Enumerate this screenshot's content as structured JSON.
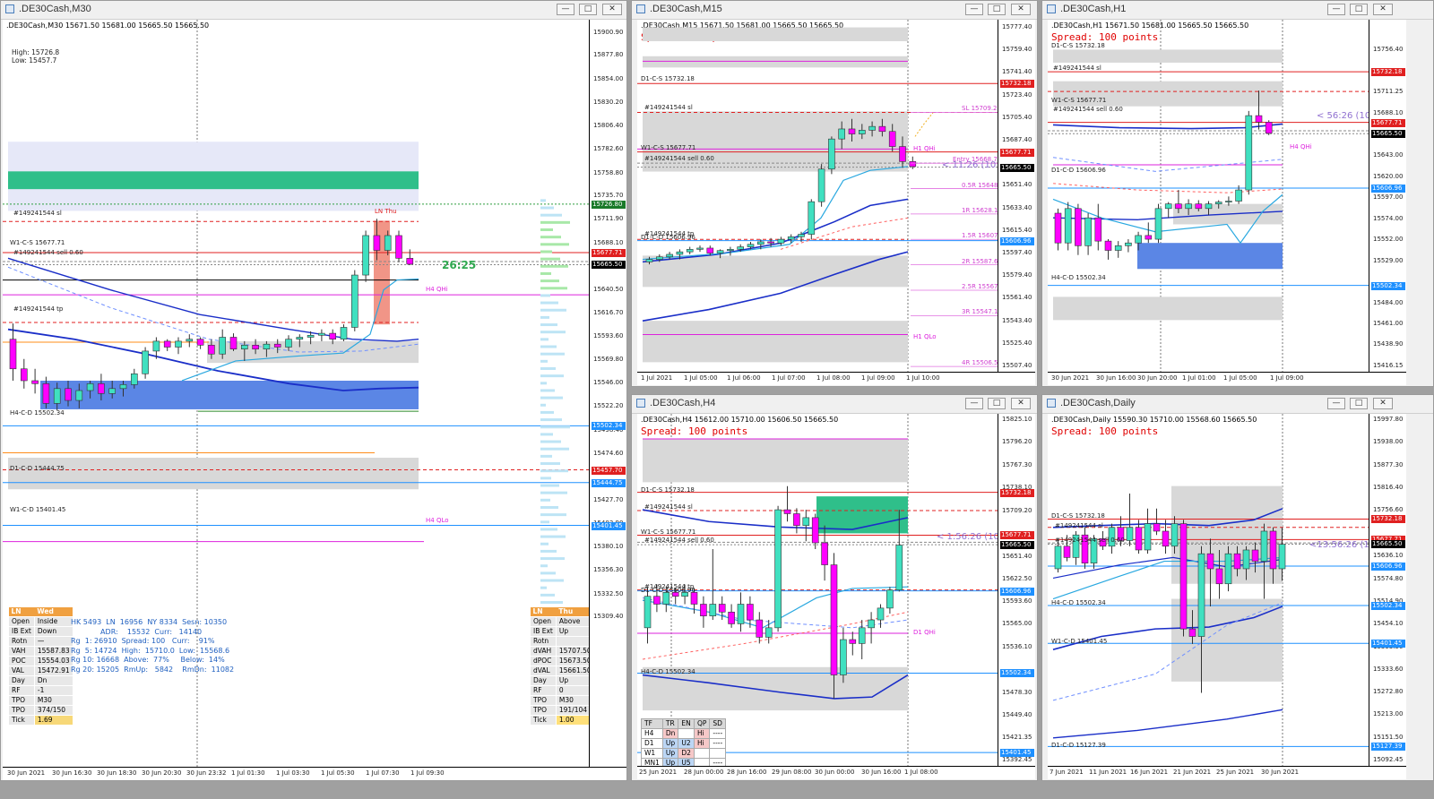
{
  "windows": {
    "m30": {
      "title": ".DE30Cash,M30",
      "header": ".DE30Cash,M30  15671.50 15681.00 15665.50 15665.50",
      "high": "High: 15726.8",
      "low": "Low: 15457.7",
      "timer": "26:25",
      "labels": {
        "sl": "#149241544 sl",
        "w1cs": "W1-C-S 15677.71",
        "sell": "#149241544 sell 0.60",
        "tp": "#149241544 tp",
        "h4qhi": "H4 QHi",
        "h4cd": "H4-C-D 15502.34",
        "d1cd": "D1-C-D 15444.75",
        "w1cd": "W1-C-D 15401.45",
        "h4qlo": "H4 QLo",
        "lnthu": "LN Thu"
      },
      "prices": [
        "15900.90",
        "15877.80",
        "15854.00",
        "15830.20",
        "15806.40",
        "15782.60",
        "15758.80",
        "15735.70",
        "15711.90",
        "15688.10",
        "15640.50",
        "15616.70",
        "15593.60",
        "15569.80",
        "15546.00",
        "15522.20",
        "15498.40",
        "15474.60",
        "15427.70",
        "15403.90",
        "15380.10",
        "15356.30",
        "15332.50",
        "15309.40"
      ],
      "price_boxes": [
        {
          "v": "15726.80",
          "color": "#1a7a2a"
        },
        {
          "v": "15677.71",
          "color": "#e02020"
        },
        {
          "v": "15665.50",
          "color": "#000000"
        },
        {
          "v": "15502.34",
          "color": "#1e90ff"
        },
        {
          "v": "15457.70",
          "color": "#e02020"
        },
        {
          "v": "15444.75",
          "color": "#1e90ff"
        },
        {
          "v": "15401.45",
          "color": "#1e90ff"
        }
      ],
      "times": [
        "30 Jun 2021",
        "30 Jun 16:30",
        "30 Jun 18:30",
        "30 Jun 20:30",
        "30 Jun 23:32",
        "1 Jul 01:30",
        "1 Jul 03:30",
        "1 Jul 05:30",
        "1 Jul 07:30",
        "1 Jul 09:30"
      ],
      "left_table": {
        "hdr": [
          "LN",
          "Wed"
        ],
        "rows": [
          [
            "Open",
            "Inside"
          ],
          [
            "IB Ext",
            "Down"
          ],
          [
            "Rotn",
            "—"
          ],
          [
            "VAH",
            "15587.83"
          ],
          [
            "POC",
            "15554.03"
          ],
          [
            "VAL",
            "15472.91"
          ],
          [
            "Day",
            "Dn"
          ],
          [
            "RF",
            "-1"
          ],
          [
            "TPO",
            "M30"
          ],
          [
            "TPO",
            "374/150"
          ],
          [
            "Tick",
            "1.69"
          ]
        ]
      },
      "stats": [
        "HK 5493  LN  16956  NY 8334  Sesn: 10350",
        "             ADR:    15532  Curr:   14140",
        "Rg  1: 26910  Spread: 100   Curr:    91%",
        "Rg  5: 14724  High:  15710.0  Low:  15568.6",
        "Rg 10: 16668  Above:  77%     Below:  14%",
        "Rg 20: 15205  RmUp:   5842    RmDn:  11082"
      ],
      "right_table": {
        "hdr": [
          "LN",
          "Thu"
        ],
        "rows": [
          [
            "Open",
            "Above"
          ],
          [
            "IB Ext",
            "Up"
          ],
          [
            "Rotn",
            ""
          ],
          [
            "dVAH",
            "15707.50"
          ],
          [
            "dPOC",
            "15673.50"
          ],
          [
            "dVAL",
            "15661.50"
          ],
          [
            "Day",
            "Up"
          ],
          [
            "RF",
            "0"
          ],
          [
            "TPO",
            "M30"
          ],
          [
            "TPO",
            "191/104"
          ],
          [
            "Tick",
            "1.00"
          ]
        ]
      }
    },
    "m15": {
      "title": ".DE30Cash,M15",
      "header": ".DE30Cash,M15  15671.50 15681.00 15665.50 15665.50",
      "spread": "Spread: 100 points",
      "timer": "< 11:26 (10",
      "labels": {
        "d1cs": "D1-C-S 15732.18",
        "sl": "#149241544 sl",
        "w1cs": "W1-C-S 15677.71",
        "sell": "#149241544 sell 0.60",
        "tp": "#149241544 tp",
        "d1cd": "D1-C-D 15606.96",
        "h1qhi": "H1 QHi",
        "h1qlo": "H1 QLo",
        "fib": [
          "SL 15709.23",
          "Entry 15668.71",
          "0.5R 15648.44",
          "1R 15628.18",
          "1.5R 15607.91",
          "2R 15587.65",
          "2.5R 15567.39",
          "3R 15547.12",
          "4R 15506.59"
        ]
      },
      "prices": [
        "15777.40",
        "15759.40",
        "15741.40",
        "15723.40",
        "15705.40",
        "15687.40",
        "15651.40",
        "15633.40",
        "15615.40",
        "15597.40",
        "15579.40",
        "15561.40",
        "15543.40",
        "15525.40",
        "15507.40"
      ],
      "price_boxes": [
        {
          "v": "15732.18",
          "color": "#e02020"
        },
        {
          "v": "15677.71",
          "color": "#e02020"
        },
        {
          "v": "15665.50",
          "color": "#000000"
        },
        {
          "v": "15606.96",
          "color": "#1e90ff"
        }
      ],
      "times": [
        "1 Jul 2021",
        "1 Jul 05:00",
        "1 Jul 06:00",
        "1 Jul 07:00",
        "1 Jul 08:00",
        "1 Jul 09:00",
        "1 Jul 10:00"
      ]
    },
    "h1": {
      "title": ".DE30Cash,H1",
      "header": ".DE30Cash,H1  15671.50 15681.00 15665.50 15665.50",
      "spread": "Spread: 100 points",
      "timer": "< 56:26 (10",
      "labels": {
        "d1cs": "D1-C-S 15732.18",
        "sl": "#149241544 sl",
        "w1cs": "W1-C-S 15677.71",
        "sell": "#149241544 sell 0.60",
        "h4qhi": "H4 QHi",
        "d1cd": "D1-C-D 15606.96",
        "h4cd": "H4-C-D 15502.34"
      },
      "prices": [
        "15756.40",
        "15711.25",
        "15688.10",
        "15643.00",
        "15620.00",
        "15597.00",
        "15574.00",
        "15552.00",
        "15529.00",
        "15484.00",
        "15461.00",
        "15438.90",
        "15416.15"
      ],
      "price_boxes": [
        {
          "v": "15732.18",
          "color": "#e02020"
        },
        {
          "v": "15677.71",
          "color": "#e02020"
        },
        {
          "v": "15665.50",
          "color": "#000000"
        },
        {
          "v": "15606.96",
          "color": "#1e90ff"
        },
        {
          "v": "15502.34",
          "color": "#1e90ff"
        }
      ],
      "times": [
        "30 Jun 2021",
        "30 Jun 16:00",
        "30 Jun 20:00",
        "1 Jul 01:00",
        "1 Jul 05:00",
        "1 Jul 09:00"
      ]
    },
    "h4": {
      "title": ".DE30Cash,H4",
      "header": ".DE30Cash,H4  15612.00 15710.00 15606.50 15665.50",
      "spread": "Spread: 100 points",
      "timer": "< 1:56:26 (10",
      "labels": {
        "d1cs": "D1-C-S 15732.18",
        "sl": "#149241544 sl",
        "w1cs": "W1-C-S 15677.71",
        "sell": "#149241544 sell 0.60",
        "tp": "#149241544 tp",
        "d1cd": "D1-C-D 15606.96",
        "d1qhi": "D1 QHi",
        "h4cd": "H4-C-D 15502.34"
      },
      "prices": [
        "15825.10",
        "15796.20",
        "15767.30",
        "15738.10",
        "15709.20",
        "15651.40",
        "15622.50",
        "15593.60",
        "15565.00",
        "15536.10",
        "15478.30",
        "15449.40",
        "15421.35",
        "15392.45"
      ],
      "price_boxes": [
        {
          "v": "15732.18",
          "color": "#e02020"
        },
        {
          "v": "15677.71",
          "color": "#e02020"
        },
        {
          "v": "15665.50",
          "color": "#000000"
        },
        {
          "v": "15606.96",
          "color": "#1e90ff"
        },
        {
          "v": "15502.34",
          "color": "#1e90ff"
        },
        {
          "v": "15401.45",
          "color": "#1e90ff"
        }
      ],
      "times": [
        "25 Jun 2021",
        "28 Jun 00:00",
        "28 Jun 16:00",
        "29 Jun 08:00",
        "30 Jun 00:00",
        "30 Jun 16:00",
        "1 Jul 08:00"
      ],
      "trend_table": {
        "hdr": [
          "TF",
          "TR",
          "EN",
          "QP",
          "SD"
        ],
        "rows": [
          [
            "H4",
            "Dn",
            "",
            "Hi",
            "----"
          ],
          [
            "D1",
            "Up",
            "U2",
            "Hi",
            "----"
          ],
          [
            "W1",
            "Up",
            "D2",
            "",
            ""
          ],
          [
            "MN1",
            "Up",
            "U5",
            "",
            "----"
          ]
        ]
      }
    },
    "daily": {
      "title": ".DE30Cash,Daily",
      "header": ".DE30Cash,Daily  15590.30 15710.00 15568.60 15665.50",
      "spread": "Spread: 100 points",
      "timer": "<13:56:26 (10",
      "labels": {
        "d1cs": "D1-C-S 15732.18",
        "sl": "#149241544 sl",
        "sell": "#149241544 sell 0.60",
        "d1cd": "D1-C-D 15127.39",
        "h4cd": "H4-C-D 15502.34",
        "w1cd": "W1-C-D 15401.45"
      },
      "prices": [
        "15997.80",
        "15938.00",
        "15877.30",
        "15816.40",
        "15756.60",
        "15636.10",
        "15574.80",
        "15514.90",
        "15454.10",
        "15393.50",
        "15333.60",
        "15272.80",
        "15213.00",
        "15151.50",
        "15092.45"
      ],
      "price_boxes": [
        {
          "v": "15732.18",
          "color": "#e02020"
        },
        {
          "v": "15677.71",
          "color": "#e02020"
        },
        {
          "v": "15665.50",
          "color": "#000000"
        },
        {
          "v": "15606.96",
          "color": "#1e90ff"
        },
        {
          "v": "15502.34",
          "color": "#1e90ff"
        },
        {
          "v": "15401.45",
          "color": "#1e90ff"
        },
        {
          "v": "15127.39",
          "color": "#1e90ff"
        }
      ],
      "times": [
        "7 Jun 2021",
        "11 Jun 2021",
        "16 Jun 2021",
        "21 Jun 2021",
        "25 Jun 2021",
        "30 Jun 2021"
      ]
    }
  },
  "colors": {
    "bull": "#40e0c0",
    "bear": "#ff00ff",
    "ma_dark": "#1a2ec8",
    "ma_light": "#1e90ff",
    "level_red": "#e02020",
    "level_blue": "#1e90ff",
    "magenta_line": "#dd22dd",
    "zone_gray": "#d8d8d8",
    "zone_blue": "#5b86e5",
    "zone_green": "#2fbf8a"
  }
}
